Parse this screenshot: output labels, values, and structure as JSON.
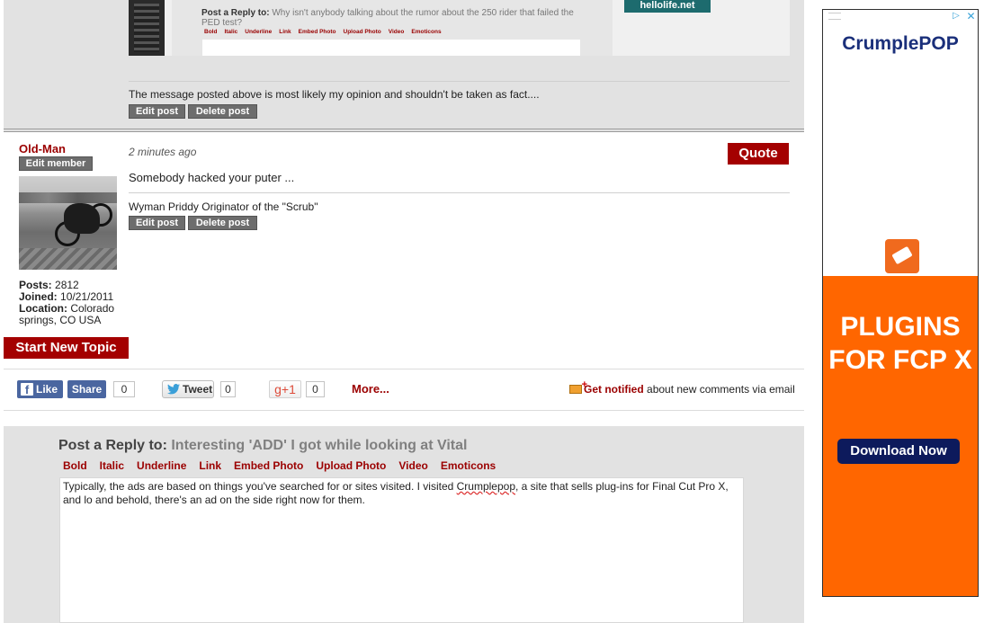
{
  "previous_post": {
    "embedded": {
      "reply_label": "Post a Reply to:",
      "reply_subject": "Why isn't anybody talking about the rumor about the 250 rider that failed the PED test?",
      "toolbar": [
        "Bold",
        "Italic",
        "Underline",
        "Link",
        "Embed Photo",
        "Upload Photo",
        "Video",
        "Emoticons"
      ],
      "ad_text": "hellolife.net"
    },
    "signature": "The message posted above is most likely my opinion and shouldn't be taken as fact....",
    "edit_label": "Edit post",
    "delete_label": "Delete post"
  },
  "post": {
    "username": "Old-Man",
    "edit_member_label": "Edit member",
    "stats": {
      "posts_label": "Posts:",
      "posts": "2812",
      "joined_label": "Joined:",
      "joined": "10/21/2011",
      "location_label": "Location:",
      "location": "Colorado springs, CO USA"
    },
    "time": "2 minutes ago",
    "quote_label": "Quote",
    "body": "Somebody hacked your puter ...",
    "signature": "Wyman Priddy Originator of the \"Scrub\"",
    "edit_label": "Edit post",
    "delete_label": "Delete post"
  },
  "start_topic_label": "Start New Topic",
  "social": {
    "like_label": "Like",
    "share_label": "Share",
    "share_count": "0",
    "tweet_label": "Tweet",
    "tweet_count": "0",
    "gplus_label": "+1",
    "gplus_count": "0",
    "more_label": "More...",
    "notify_link": "Get notified",
    "notify_text": "about new comments via email"
  },
  "reply": {
    "label": "Post a Reply to:",
    "subject": "Interesting 'ADD' I got while looking at Vital",
    "toolbar": [
      "Bold",
      "Italic",
      "Underline",
      "Link",
      "Embed Photo",
      "Upload Photo",
      "Video",
      "Emoticons"
    ],
    "text_before": "Typically, the ads are based on things you've searched for or sites visited. I visited ",
    "text_spell": "Crumplepop",
    "text_after": ", a site that sells plug-ins for Final Cut Pro X, and lo and behold, there's an ad on the side right now for them."
  },
  "ad": {
    "brand": "CrumplePOP",
    "headline": "PLUGINS FOR FCP X",
    "cta": "Download Now",
    "choice_icon": "ad-choices-icon",
    "close_icon": "close-icon",
    "accent": "#ff6600",
    "brand_color": "#1a2f7a"
  },
  "colors": {
    "link_red": "#9b0000",
    "button_red": "#a40000",
    "section_grey": "#e2e2e2",
    "facebook_blue": "#4a66a0"
  }
}
